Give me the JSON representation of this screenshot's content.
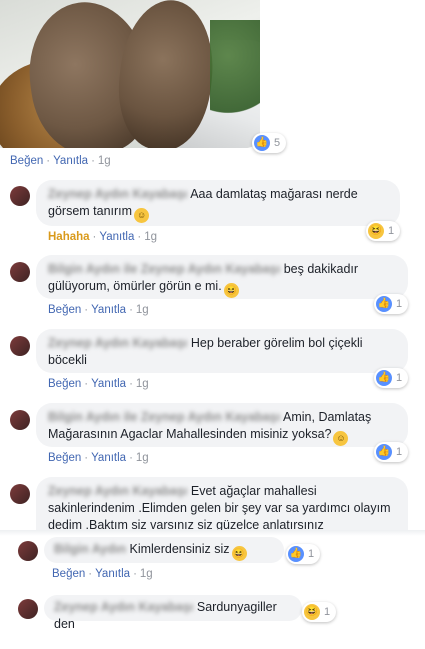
{
  "photo": {
    "reaction_count": "5"
  },
  "post_actions": {
    "like": "Beğen",
    "reply": "Yanıtla",
    "time": "1g"
  },
  "comments": [
    {
      "name": "Zeynep Aydın Kayabaşı",
      "text": "Aaa damlataş mağarası nerde görsem tanırım",
      "actions": {
        "reaction": "Hahaha",
        "reply": "Yanıtla",
        "time": "1g"
      },
      "reaction_count": "1"
    },
    {
      "name": "Bilgin Aydın ile Zeynep Aydın Kayabaşı",
      "text": "beş dakikadır gülüyorum, ömürler görün e mi.",
      "actions": {
        "like": "Beğen",
        "reply": "Yanıtla",
        "time": "1g"
      },
      "reaction_count": "1"
    },
    {
      "name": "Zeynep Aydın Kayabaşı",
      "text": "Hep beraber görelim bol çiçekli böcekli",
      "actions": {
        "like": "Beğen",
        "reply": "Yanıtla",
        "time": "1g"
      },
      "reaction_count": "1"
    },
    {
      "name": "Bilgin Aydın ile Zeynep Aydın Kayabaşı",
      "text": "Amin, Damlataş Mağarasının Agaclar Mahallesinden misiniz yoksa?",
      "actions": {
        "like": "Beğen",
        "reply": "Yanıtla",
        "time": "1g"
      },
      "reaction_count": "1"
    },
    {
      "name": "Zeynep Aydın Kayabaşı",
      "text": "Evet ağaçlar mahallesi sakinlerindenim .Elimden gelen bir şey var sa yardımcı olayım dedim .Baktım siz varsınız siz güzelce anlatırsınız"
    },
    {
      "name": "Bilgin Aydın",
      "text": "Kimlerdensiniz siz",
      "actions": {
        "like": "Beğen",
        "reply": "Yanıtla",
        "time": "1g"
      },
      "reaction_count": "1"
    },
    {
      "name": "Zeynep Aydın Kayabaşı",
      "text": "Sardunyagiller den",
      "reaction_count": "1"
    }
  ],
  "colors": {
    "like_blue": "#5890ff",
    "link_blue": "#4267b2",
    "haha_orange": "#d99a1b",
    "bubble_bg": "#f2f3f5"
  },
  "icons": {
    "like": "thumbs-up-icon",
    "haha": "laughing-face-icon",
    "smile": "smiling-face-icon"
  }
}
